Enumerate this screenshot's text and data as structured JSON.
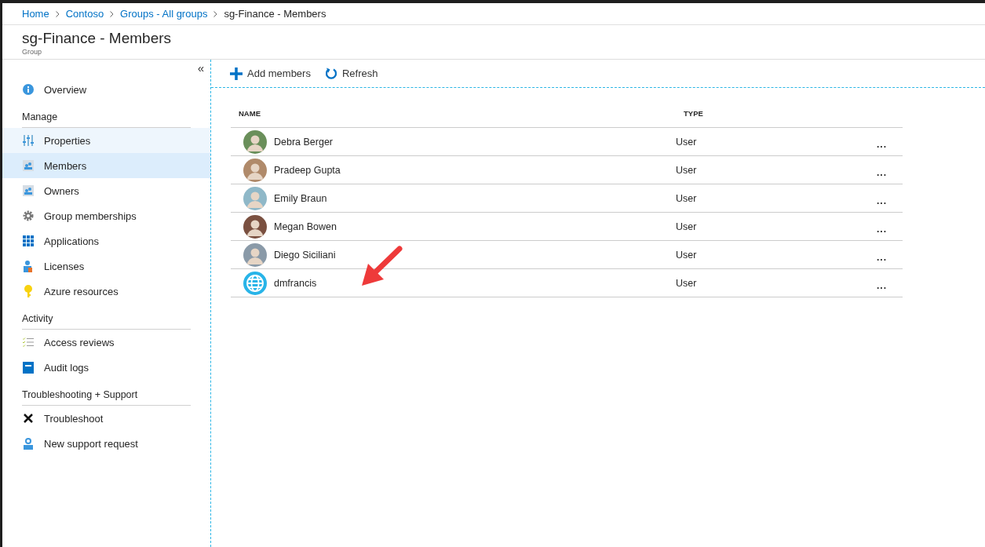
{
  "breadcrumb": [
    {
      "label": "Home",
      "link": true
    },
    {
      "label": "Contoso",
      "link": true
    },
    {
      "label": "Groups - All groups",
      "link": true
    },
    {
      "label": "sg-Finance - Members",
      "link": false
    }
  ],
  "header": {
    "title": "sg-Finance - Members",
    "subtitle": "Group"
  },
  "sidebar": {
    "collapse": "«",
    "top_items": [
      {
        "label": "Overview",
        "selected": false,
        "hovered": false
      }
    ],
    "sections": [
      {
        "title": "Manage",
        "items": [
          {
            "label": "Properties",
            "selected": false,
            "hovered": true
          },
          {
            "label": "Members",
            "selected": true,
            "hovered": false
          },
          {
            "label": "Owners",
            "selected": false,
            "hovered": false
          },
          {
            "label": "Group memberships",
            "selected": false,
            "hovered": false
          },
          {
            "label": "Applications",
            "selected": false,
            "hovered": false
          },
          {
            "label": "Licenses",
            "selected": false,
            "hovered": false
          },
          {
            "label": "Azure resources",
            "selected": false,
            "hovered": false
          }
        ]
      },
      {
        "title": "Activity",
        "items": [
          {
            "label": "Access reviews",
            "selected": false,
            "hovered": false
          },
          {
            "label": "Audit logs",
            "selected": false,
            "hovered": false
          }
        ]
      },
      {
        "title": "Troubleshooting + Support",
        "items": [
          {
            "label": "Troubleshoot",
            "selected": false,
            "hovered": false
          },
          {
            "label": "New support request",
            "selected": false,
            "hovered": false
          }
        ]
      }
    ]
  },
  "toolbar": [
    {
      "label": "Add members",
      "kind": "add"
    },
    {
      "label": "Refresh",
      "kind": "refresh"
    }
  ],
  "table": {
    "columns": [
      "NAME",
      "TYPE"
    ],
    "rows": [
      {
        "name": "Debra Berger",
        "type": "User",
        "kind": "photo",
        "more": "..."
      },
      {
        "name": "Pradeep Gupta",
        "type": "User",
        "kind": "photo",
        "more": "..."
      },
      {
        "name": "Emily Braun",
        "type": "User",
        "kind": "photo",
        "more": "..."
      },
      {
        "name": "Megan Bowen",
        "type": "User",
        "kind": "photo",
        "more": "..."
      },
      {
        "name": "Diego Siciliani",
        "type": "User",
        "kind": "photo",
        "more": "..."
      },
      {
        "name": "dmfrancis",
        "type": "User",
        "kind": "globe",
        "more": "..."
      }
    ]
  }
}
